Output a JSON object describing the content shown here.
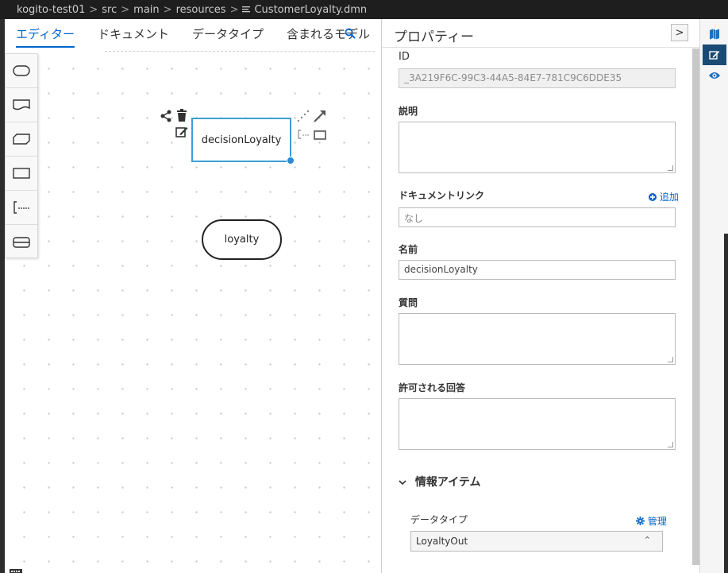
{
  "breadcrumb": {
    "items": [
      "kogito-test01",
      "src",
      "main",
      "resources"
    ],
    "file": "CustomerLoyalty.dmn",
    "separator": ">"
  },
  "editor": {
    "tabs": [
      {
        "label": "エディター",
        "active": true
      },
      {
        "label": "ドキュメント",
        "active": false
      },
      {
        "label": "データタイプ",
        "active": false
      },
      {
        "label": "含まれるモデル",
        "active": false
      }
    ],
    "palette": [
      "input-data-tool",
      "knowledge-source-tool",
      "bkm-tool",
      "decision-tool",
      "annotation-tool",
      "decision-service-tool"
    ],
    "nodes": {
      "decision": "decisionLoyalty",
      "input": "loyalty"
    },
    "node_toolbar_icons": [
      "share-icon",
      "delete-icon",
      "edit-icon",
      "dotted-connector-icon",
      "arrow-connector-icon",
      "annotation-connector-icon",
      "node-shape-icon"
    ]
  },
  "properties": {
    "title": "プロパティー",
    "collapse_label": ">",
    "id_label": "ID",
    "id_value": "_3A219F6C-99C3-44A5-84E7-781C9C6DDE35",
    "description_label": "説明",
    "doc_links_label": "ドキュメントリンク",
    "add_label": "追加",
    "doc_links_placeholder": "なし",
    "name_label": "名前",
    "name_value": "decisionLoyalty",
    "question_label": "質問",
    "allowed_answers_label": "許可される回答",
    "info_item_label": "情報アイテム",
    "data_type_label": "データタイプ",
    "manage_label": "管理",
    "data_type_value": "LoyaltyOut"
  },
  "rightbar": [
    "map-icon",
    "edit-icon",
    "eye-icon"
  ],
  "colors": {
    "accent": "#0066cc",
    "selection": "#3c9fd6",
    "active_side_button": "#1a4b75"
  }
}
